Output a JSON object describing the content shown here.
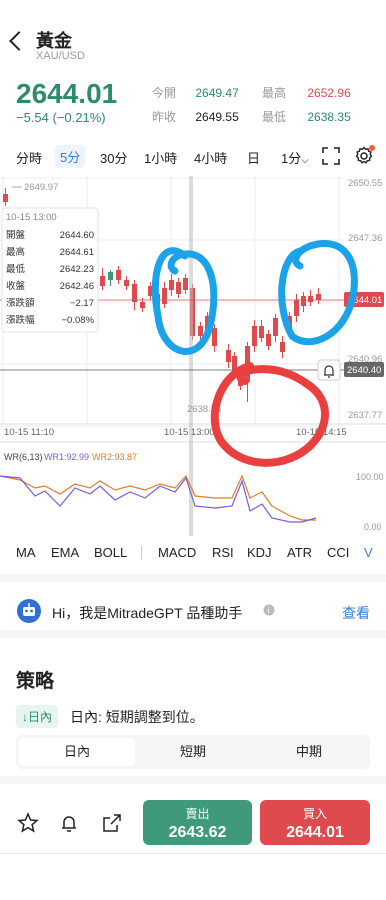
{
  "header": {
    "title": "黃金",
    "subtitle": "XAU/USD"
  },
  "quote": {
    "price": "2644.01",
    "change": "−5.54 (−0.21%)",
    "open_label": "今開",
    "open": "2649.47",
    "high_label": "最高",
    "high": "2652.96",
    "prev_label": "昨收",
    "prev": "2649.55",
    "low_label": "最低",
    "low": "2638.35"
  },
  "timeframes": [
    "分時",
    "5分",
    "30分",
    "1小時",
    "4小時",
    "日",
    "1分"
  ],
  "chart": {
    "price_axis": [
      "2650.55",
      "2647.36",
      "2644.01",
      "2640.96",
      "2640.40",
      "2637.77"
    ],
    "top_left_label": "2649.97",
    "low_marker_label": "2638.35",
    "time_labels": [
      "10-15 11:10",
      "10-15 13:00",
      "10-15 14:15"
    ],
    "tooltip": {
      "time": "10-15 13:00",
      "rows": [
        {
          "k": "開盤",
          "v": "2644.60"
        },
        {
          "k": "最高",
          "v": "2644.61"
        },
        {
          "k": "最低",
          "v": "2642.23"
        },
        {
          "k": "收盤",
          "v": "2642.46"
        },
        {
          "k": "漲跌額",
          "v": "−2.17"
        },
        {
          "k": "漲跌幅",
          "v": "−0.08%"
        }
      ]
    },
    "wr": {
      "label": "WR(6,13)",
      "wr1_label": "WR1:92.99",
      "wr2_label": "WR2:93.87",
      "axis": [
        "100.00",
        "0.00"
      ]
    },
    "colors": {
      "up": "#3f9a7a",
      "down": "#df4a4f",
      "wr1": "#7b5cd6",
      "wr2": "#e07d2c",
      "annot_blue": "#1aa3e8",
      "annot_red": "#ea3f3f"
    }
  },
  "indicators": [
    "MA",
    "EMA",
    "BOLL",
    "MACD",
    "RSI",
    "KDJ",
    "ATR",
    "CCI",
    "V"
  ],
  "assistant": {
    "text": "Hi，我是MitradeGPT 品種助手",
    "link": "查看"
  },
  "strategy": {
    "title": "策略",
    "badge": "↓日內",
    "text": "日內: 短期調整到位。",
    "tabs": [
      "日內",
      "短期",
      "中期"
    ]
  },
  "trade": {
    "sell_label": "賣出",
    "sell_price": "2643.62",
    "buy_label": "買入",
    "buy_price": "2644.01"
  }
}
